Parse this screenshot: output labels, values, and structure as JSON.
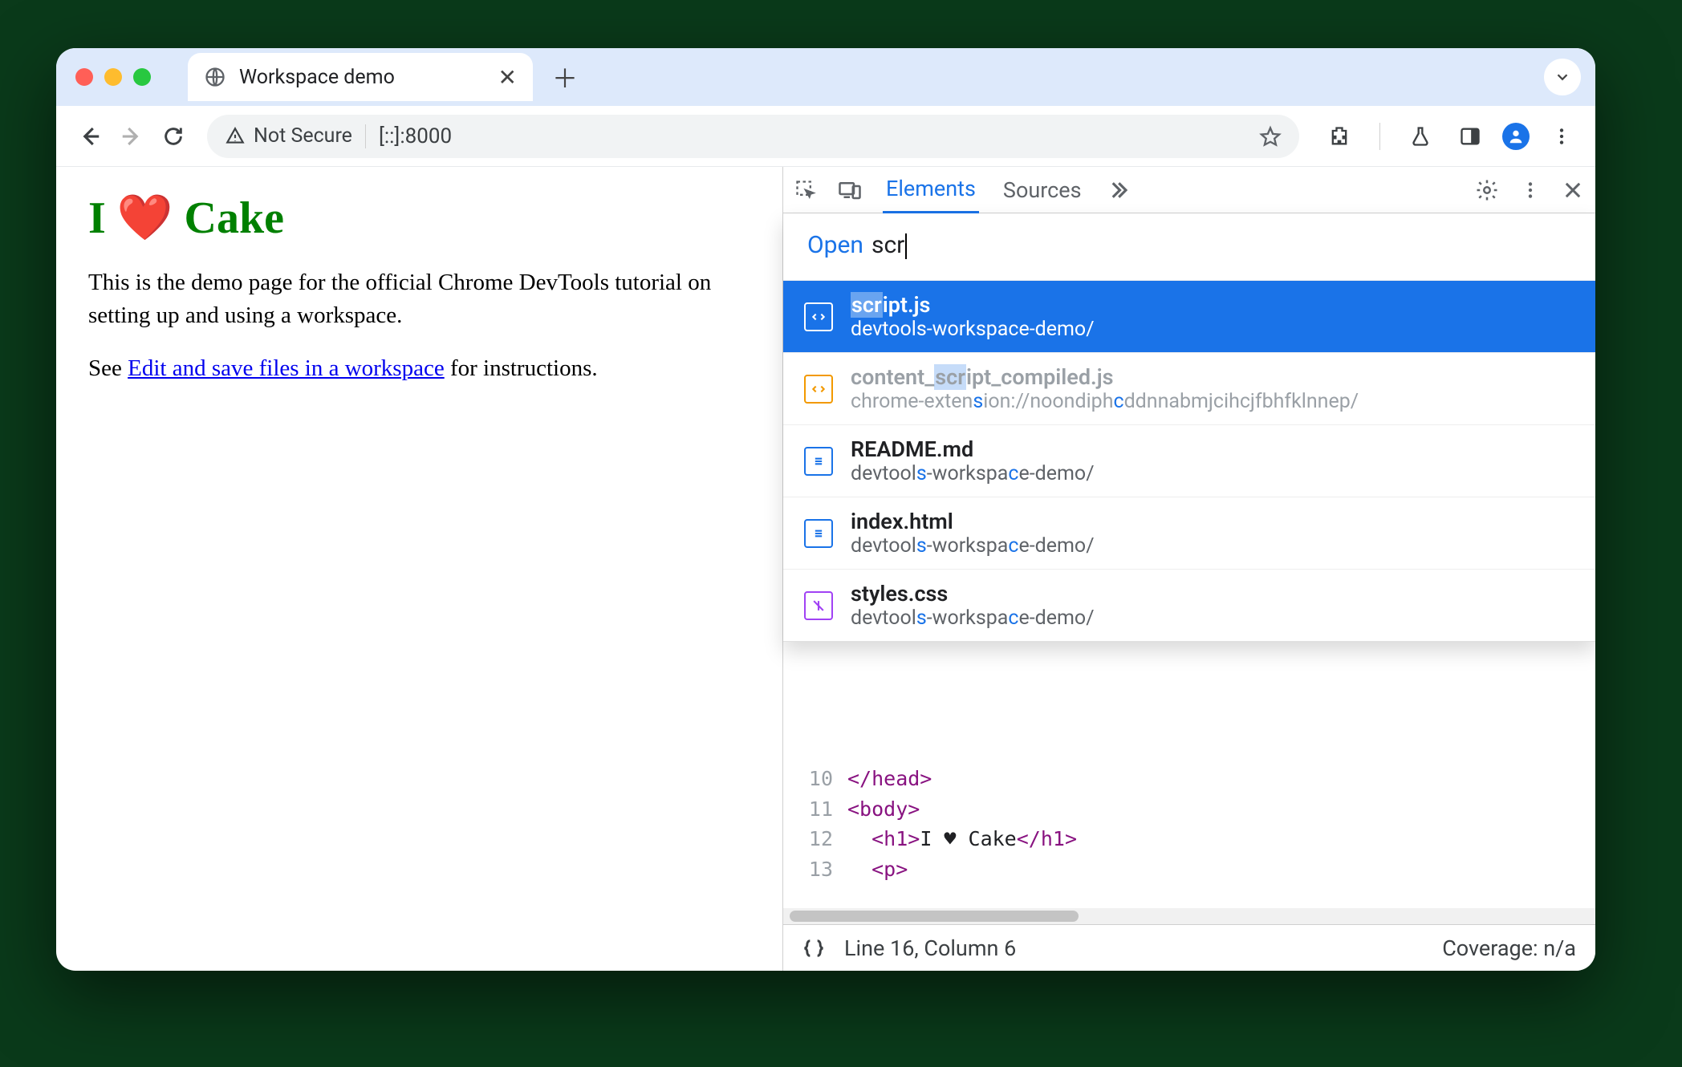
{
  "browser": {
    "tab_title": "Workspace demo",
    "security_label": "Not Secure",
    "url": "[::]:8000"
  },
  "page": {
    "heading": "I ❤️ Cake",
    "para1": "This is the demo page for the official Chrome DevTools tutorial on setting up and using a workspace.",
    "para2_prefix": "See ",
    "para2_link": "Edit and save files in a workspace",
    "para2_suffix": " for instructions."
  },
  "devtools": {
    "tabs": {
      "elements": "Elements",
      "sources": "Sources"
    },
    "open": {
      "label": "Open",
      "query": "scr",
      "results": [
        {
          "name": "script.js",
          "path": "devtools-workspace-demo/",
          "icon": "js",
          "selected": true
        },
        {
          "name": "content_script_compiled.js",
          "path": "chrome-extension://noondiphcddnnabmjcihcjfbhfklnnep/",
          "icon": "ext",
          "dim": true
        },
        {
          "name": "README.md",
          "path": "devtools-workspace-demo/",
          "icon": "doc"
        },
        {
          "name": "index.html",
          "path": "devtools-workspace-demo/",
          "icon": "doc"
        },
        {
          "name": "styles.css",
          "path": "devtools-workspace-demo/",
          "icon": "css"
        }
      ]
    },
    "editor": {
      "lines": [
        {
          "n": "10",
          "html": "&lt;/head&gt;"
        },
        {
          "n": "11",
          "html": "&lt;body&gt;"
        },
        {
          "n": "12",
          "html": "  &lt;h1&gt;I ♥ Cake&lt;/h1&gt;"
        },
        {
          "n": "13",
          "html": "  &lt;p&gt;"
        }
      ]
    },
    "status": {
      "pos": "Line 16, Column 6",
      "coverage": "Coverage: n/a"
    }
  }
}
